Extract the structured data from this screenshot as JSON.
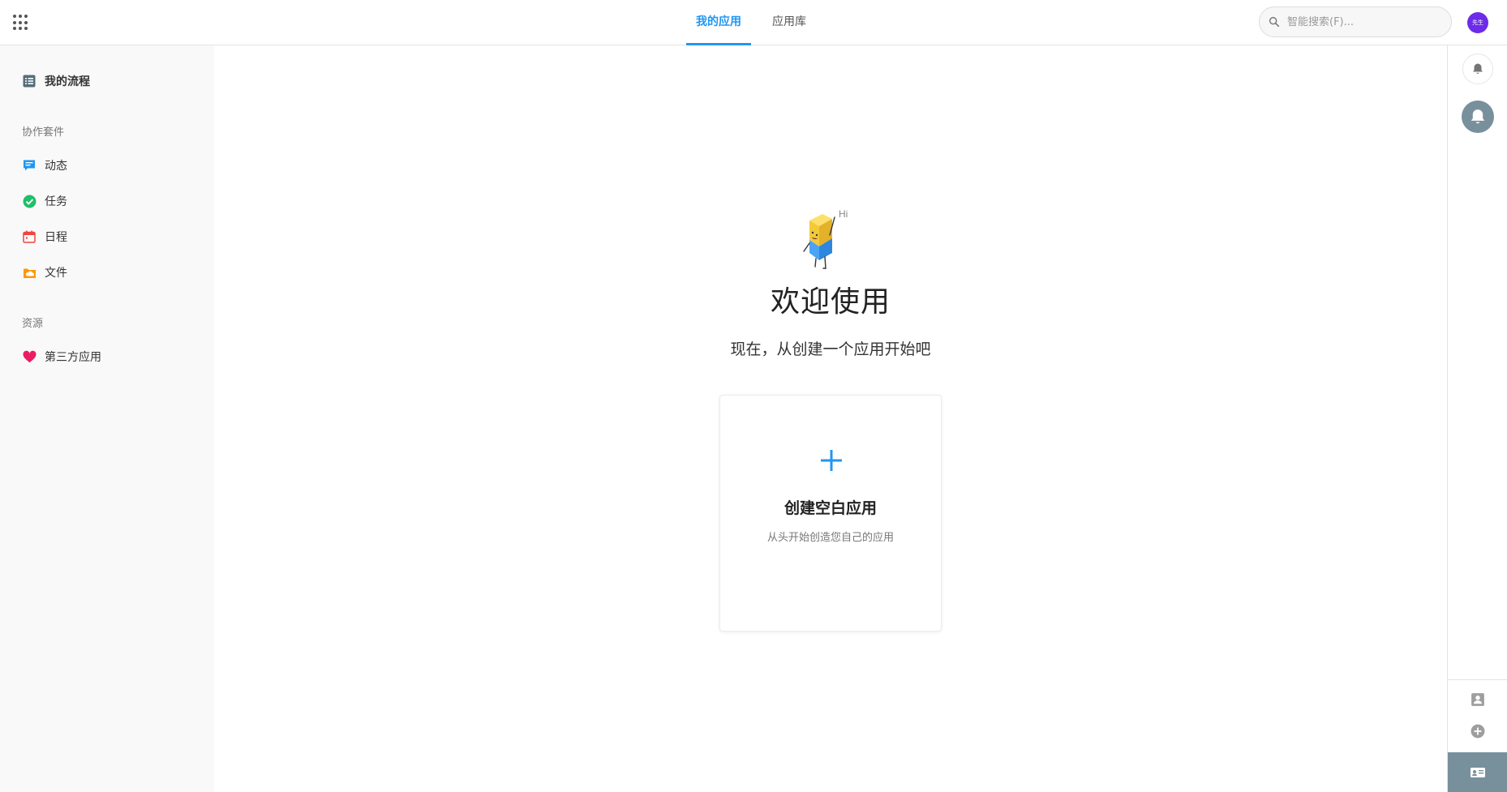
{
  "header": {
    "tabs": [
      {
        "label": "我的应用",
        "active": true
      },
      {
        "label": "应用库",
        "active": false
      }
    ],
    "search": {
      "placeholder": "智能搜索(F)..."
    },
    "avatar_text": "先生"
  },
  "sidebar": {
    "my_process": "我的流程",
    "section_collab": "协作套件",
    "collab_items": [
      {
        "label": "动态",
        "icon": "chat-icon"
      },
      {
        "label": "任务",
        "icon": "check-circle-icon"
      },
      {
        "label": "日程",
        "icon": "calendar-icon"
      },
      {
        "label": "文件",
        "icon": "cloud-folder-icon"
      }
    ],
    "section_resources": "资源",
    "resource_items": [
      {
        "label": "第三方应用",
        "icon": "heart-icon"
      }
    ]
  },
  "main": {
    "mascot_text": "Hi",
    "welcome": "欢迎使用",
    "subtitle": "现在，从创建一个应用开始吧",
    "card": {
      "title": "创建空白应用",
      "description": "从头开始创造您自己的应用"
    }
  },
  "colors": {
    "accent": "#2196f3",
    "avatar": "#6c2ce8",
    "sidebar_bg": "#f9f9f9",
    "notif_gray": "#78909c"
  }
}
